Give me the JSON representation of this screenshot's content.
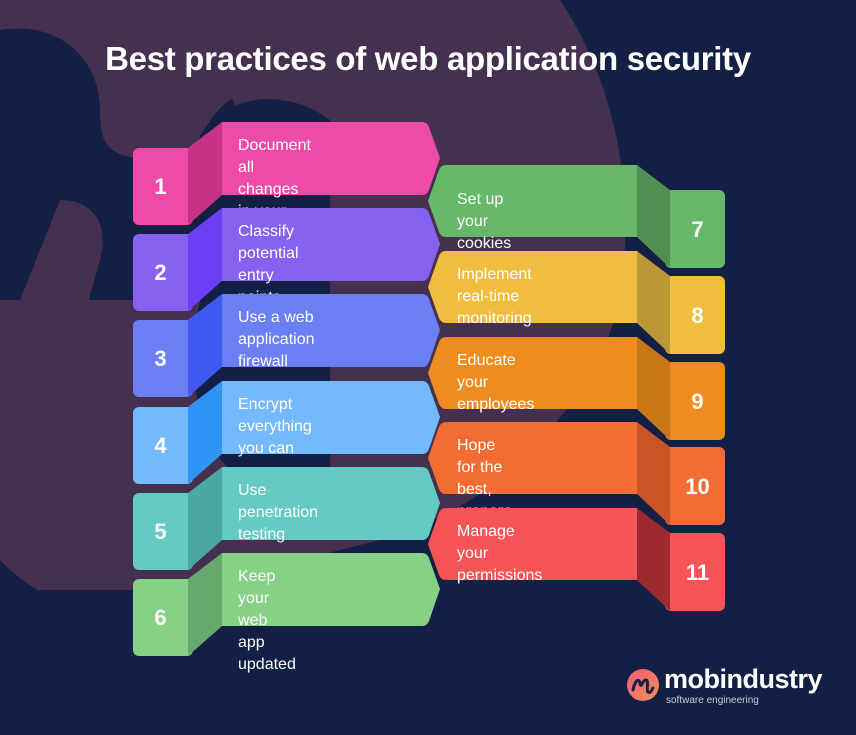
{
  "title": "Best practices of web application security",
  "colors": {
    "background": "#131f44",
    "background_shape": "#45304f"
  },
  "left_items": [
    {
      "number": "1",
      "text": "Document all changes\nin your software",
      "color": "#ee4ba9",
      "side_color": "#c63386"
    },
    {
      "number": "2",
      "text": "Classify potential entry\npoints for hackers",
      "color": "#8761ef",
      "side_color": "#6c3ef5"
    },
    {
      "number": "3",
      "text": "Use a web\napplication firewall",
      "color": "#6a7ff3",
      "side_color": "#3f59f2"
    },
    {
      "number": "4",
      "text": "Encrypt everything\nyou can",
      "color": "#74b9fb",
      "side_color": "#2e95f7"
    },
    {
      "number": "5",
      "text": "Use penetration\ntesting",
      "color": "#65cac3",
      "side_color": "#4aa8a1"
    },
    {
      "number": "6",
      "text": "Keep your web\napp updated",
      "color": "#86d185",
      "side_color": "#67a96b"
    }
  ],
  "right_items": [
    {
      "number": "7",
      "text": "Set up your cookies",
      "color": "#67b869",
      "side_color": "#518f53"
    },
    {
      "number": "8",
      "text": "Implement real-time\nmonitoring",
      "color": "#f0bd3e",
      "side_color": "#bb9735"
    },
    {
      "number": "9",
      "text": "Educate your\nemployees",
      "color": "#ee8c1f",
      "side_color": "#c77716"
    },
    {
      "number": "10",
      "text": "Hope for the best,\nprepare for the worst",
      "color": "#f26c33",
      "side_color": "#c95428"
    },
    {
      "number": "11",
      "text": "Manage your\npermissions",
      "color": "#f65457",
      "side_color": "#9c2a30"
    }
  ],
  "logo": {
    "name": "mobindustry",
    "tagline": "software engineering",
    "icon": "mobindustry-logo-icon",
    "gradient": [
      "#f05a7e",
      "#f4904a"
    ]
  }
}
